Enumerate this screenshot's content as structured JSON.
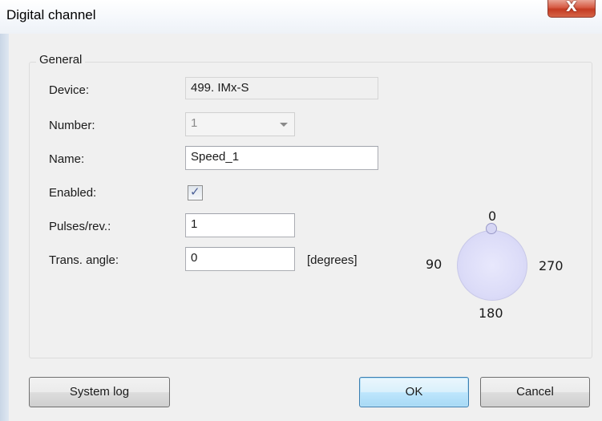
{
  "window": {
    "title": "Digital channel",
    "close_glyph": "X"
  },
  "general": {
    "legend": "General",
    "device_label": "Device:",
    "device_value": "499. IMx-S",
    "number_label": "Number:",
    "number_value": "1",
    "name_label": "Name:",
    "name_value": "Speed_1",
    "enabled_label": "Enabled:",
    "enabled_checked": true,
    "enabled_glyph": "✓",
    "pulses_label": "Pulses/rev.:",
    "pulses_value": "1",
    "angle_label": "Trans. angle:",
    "angle_value": "0",
    "angle_unit": "[degrees]"
  },
  "dial": {
    "label_top": "0",
    "label_left": "90",
    "label_right": "270",
    "label_bottom": "180",
    "fill_color": "#dcdcf8"
  },
  "buttons": {
    "system_log": "System log",
    "ok": "OK",
    "cancel": "Cancel"
  },
  "colors": {
    "close_button": "#c43b22",
    "default_button_border": "#3c7fb1",
    "checkbox_tick": "#4a5f97"
  }
}
